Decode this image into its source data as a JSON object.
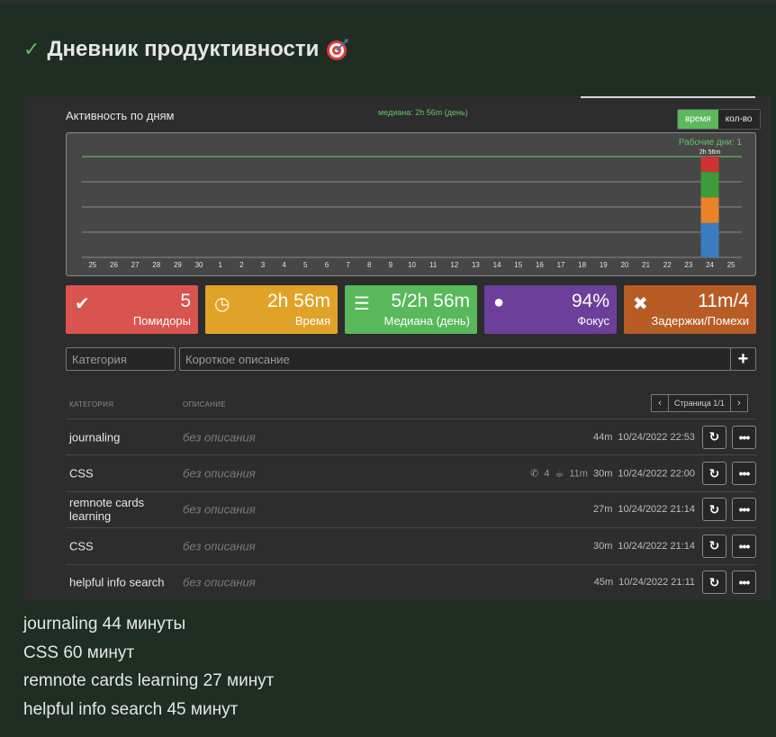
{
  "header": {
    "title": "Дневник продуктивности",
    "check_icon": "✓",
    "emoji_icon": "target-icon"
  },
  "chart": {
    "title": "Активность по дням",
    "median_label": "медиана: 2h 56m (день)",
    "toggle": {
      "time_label": "время",
      "count_label": "кол-во",
      "active": "время"
    },
    "workdays_label": "Рабочие дни: 1",
    "bar_label": "2h 56m"
  },
  "chart_data": {
    "type": "bar",
    "stacked": true,
    "categories": [
      "25",
      "26",
      "27",
      "28",
      "29",
      "30",
      "1",
      "2",
      "3",
      "4",
      "5",
      "6",
      "7",
      "8",
      "9",
      "10",
      "11",
      "12",
      "13",
      "14",
      "15",
      "16",
      "17",
      "18",
      "19",
      "20",
      "21",
      "22",
      "23",
      "24",
      "25"
    ],
    "unit": "minutes",
    "ylim": [
      0,
      176
    ],
    "grid": true,
    "median_line": 176,
    "series": [
      {
        "color": "#3a7cc0",
        "values": [
          0,
          0,
          0,
          0,
          0,
          0,
          0,
          0,
          0,
          0,
          0,
          0,
          0,
          0,
          0,
          0,
          0,
          0,
          0,
          0,
          0,
          0,
          0,
          0,
          0,
          0,
          0,
          0,
          0,
          60,
          0
        ]
      },
      {
        "color": "#e8832a",
        "values": [
          0,
          0,
          0,
          0,
          0,
          0,
          0,
          0,
          0,
          0,
          0,
          0,
          0,
          0,
          0,
          0,
          0,
          0,
          0,
          0,
          0,
          0,
          0,
          0,
          0,
          0,
          0,
          0,
          0,
          45,
          0
        ]
      },
      {
        "color": "#3a9c3a",
        "values": [
          0,
          0,
          0,
          0,
          0,
          0,
          0,
          0,
          0,
          0,
          0,
          0,
          0,
          0,
          0,
          0,
          0,
          0,
          0,
          0,
          0,
          0,
          0,
          0,
          0,
          0,
          0,
          0,
          0,
          44,
          0
        ]
      },
      {
        "color": "#cc3333",
        "values": [
          0,
          0,
          0,
          0,
          0,
          0,
          0,
          0,
          0,
          0,
          0,
          0,
          0,
          0,
          0,
          0,
          0,
          0,
          0,
          0,
          0,
          0,
          0,
          0,
          0,
          0,
          0,
          0,
          0,
          27,
          0
        ]
      }
    ]
  },
  "stats": [
    {
      "value": "5",
      "label": "Помидоры",
      "color": "#d9534f",
      "icon": "check-circle-icon",
      "glyph": "✔"
    },
    {
      "value": "2h 56m",
      "label": "Время",
      "color": "#e0a328",
      "icon": "clock-icon",
      "glyph": "◷"
    },
    {
      "value": "5/2h 56m",
      "label": "Медиана (день)",
      "color": "#58b85a",
      "icon": "list-icon",
      "glyph": "☰"
    },
    {
      "value": "94%",
      "label": "Фокус",
      "color": "#6b3f9a",
      "icon": "lightbulb-icon",
      "glyph": "●"
    },
    {
      "value": "11m/4",
      "label": "Задержки/Помехи",
      "color": "#b85c25",
      "icon": "times-icon",
      "glyph": "✖"
    }
  ],
  "form": {
    "category_placeholder": "Категория",
    "description_placeholder": "Короткое описание",
    "add_glyph": "+"
  },
  "table": {
    "col_category": "КАТЕГОРИЯ",
    "col_description": "ОПИСАНИЕ",
    "pager_prev": "‹",
    "pager_next": "›",
    "pager_label": "Страница 1/1",
    "redo_glyph": "↻",
    "more_glyph": "•••",
    "rows": [
      {
        "category": "journaling",
        "description": "без описания",
        "interruptions": "",
        "breaks": "",
        "duration": "44m",
        "datetime": "10/24/2022 22:53"
      },
      {
        "category": "CSS",
        "description": "без описания",
        "interruptions": "4",
        "breaks": "11m",
        "duration": "30m",
        "datetime": "10/24/2022 22:00"
      },
      {
        "category": "remnote cards learning",
        "description": "без описания",
        "interruptions": "",
        "breaks": "",
        "duration": "27m",
        "datetime": "10/24/2022 21:14"
      },
      {
        "category": "CSS",
        "description": "без описания",
        "interruptions": "",
        "breaks": "",
        "duration": "30m",
        "datetime": "10/24/2022 21:14"
      },
      {
        "category": "helpful info search",
        "description": "без описания",
        "interruptions": "",
        "breaks": "",
        "duration": "45m",
        "datetime": "10/24/2022 21:11"
      }
    ]
  },
  "notes": [
    "journaling 44 минуты",
    "CSS 60 минут",
    "remnote cards learning 27 минут",
    "helpful info search 45 минут"
  ]
}
